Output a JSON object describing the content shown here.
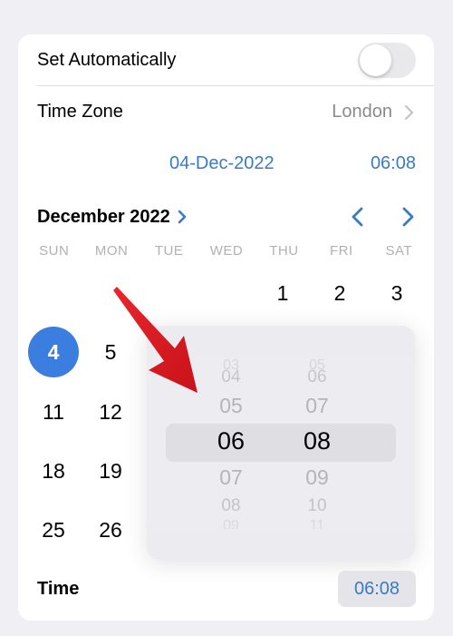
{
  "settings": {
    "set_automatically_label": "Set Automatically",
    "set_automatically_on": false,
    "time_zone_label": "Time Zone",
    "time_zone_value": "London",
    "date_value": "04-Dec-2022",
    "time_value": "06:08"
  },
  "calendar": {
    "month_label": "December 2022",
    "weekdays": [
      "SUN",
      "MON",
      "TUE",
      "WED",
      "THU",
      "FRI",
      "SAT"
    ],
    "days": {
      "d1": "1",
      "d2": "2",
      "d3": "3",
      "d4": "4",
      "d5": "5",
      "d11": "11",
      "d12": "12",
      "d18": "18",
      "d19": "19",
      "d25": "25",
      "d26": "26"
    },
    "selected_day": "4"
  },
  "time_picker": {
    "hours": {
      "far": "03",
      "prev2": "04",
      "prev1": "05",
      "selected": "06",
      "next1": "07",
      "next2": "08",
      "far2": "09"
    },
    "minutes": {
      "far": "05",
      "prev2": "06",
      "prev1": "07",
      "selected": "08",
      "next1": "09",
      "next2": "10",
      "far2": "11"
    }
  },
  "footer": {
    "time_label": "Time",
    "time_value": "06:08"
  },
  "colors": {
    "accent": "#3b7bbf",
    "selected_day_bg": "#3c7ee0",
    "arrow": "#d4151b"
  }
}
